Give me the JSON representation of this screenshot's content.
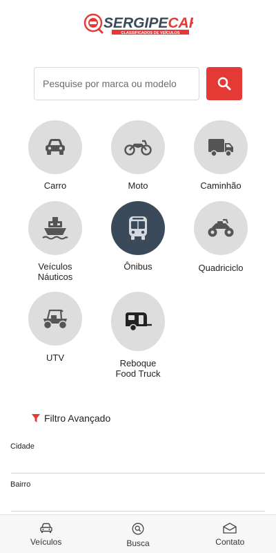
{
  "logo": {
    "brand_part1": "SERGIPE",
    "brand_part2": "CAR",
    "tagline": "CLASSIFICADOS DE VEÍCULOS"
  },
  "search": {
    "placeholder": "Pesquise por marca ou modelo"
  },
  "categories": [
    {
      "label": "Carro",
      "icon": "car-icon",
      "active": false
    },
    {
      "label": "Moto",
      "icon": "motorcycle-icon",
      "active": false
    },
    {
      "label": "Caminhão",
      "icon": "truck-icon",
      "active": false
    },
    {
      "label": "Veículos\nNáuticos",
      "icon": "ship-icon",
      "active": false
    },
    {
      "label": "Ônibus",
      "icon": "bus-icon",
      "active": true
    },
    {
      "label": "Quadriciclo",
      "icon": "atv-icon",
      "active": false
    },
    {
      "label": "UTV",
      "icon": "utv-icon",
      "active": false
    },
    {
      "label": "Reboque\nFood Truck",
      "icon": "trailer-icon",
      "active": false
    }
  ],
  "filter": {
    "title": "Filtro Avançado",
    "fields": [
      "Cidade",
      "Bairro"
    ]
  },
  "bottom_nav": [
    {
      "label": "Veículos",
      "icon": "car-outline-icon"
    },
    {
      "label": "Busca",
      "icon": "search-circle-icon"
    },
    {
      "label": "Contato",
      "icon": "envelope-icon"
    }
  ],
  "colors": {
    "accent": "#e53935",
    "active_circle": "#3b4a5a",
    "icon": "#555555"
  }
}
